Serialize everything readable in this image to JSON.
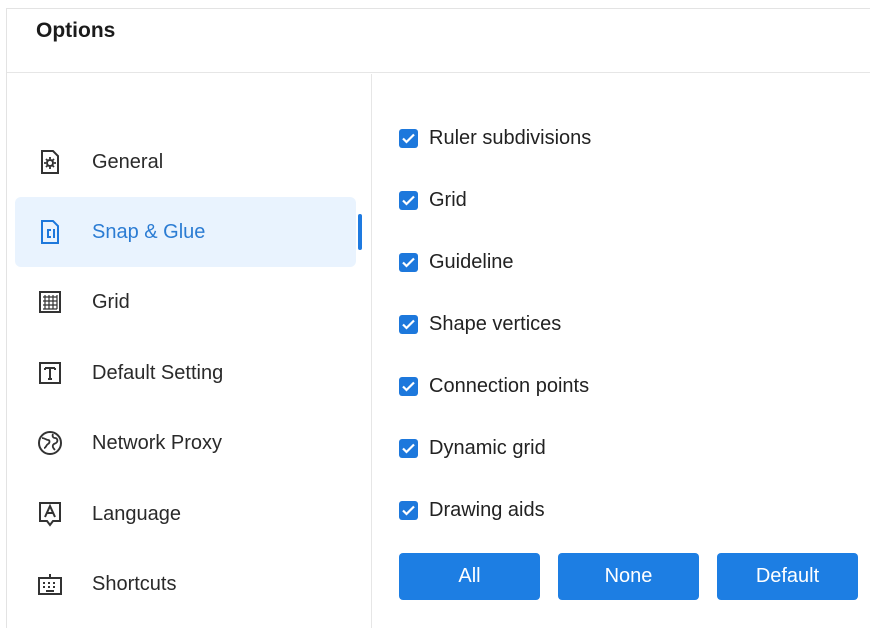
{
  "window": {
    "title": "Options"
  },
  "sidebar": {
    "items": [
      {
        "label": "General",
        "icon": "gear-doc-icon",
        "active": false
      },
      {
        "label": "Snap & Glue",
        "icon": "snap-glue-icon",
        "active": true
      },
      {
        "label": "Grid",
        "icon": "grid-icon",
        "active": false
      },
      {
        "label": "Default Setting",
        "icon": "text-box-icon",
        "active": false
      },
      {
        "label": "Network Proxy",
        "icon": "globe-icon",
        "active": false
      },
      {
        "label": "Language",
        "icon": "language-icon",
        "active": false
      },
      {
        "label": "Shortcuts",
        "icon": "keyboard-icon",
        "active": false
      }
    ]
  },
  "options": {
    "items": [
      {
        "label": "Ruler subdivisions",
        "checked": true
      },
      {
        "label": "Grid",
        "checked": true
      },
      {
        "label": "Guideline",
        "checked": true
      },
      {
        "label": "Shape vertices",
        "checked": true
      },
      {
        "label": "Connection points",
        "checked": true
      },
      {
        "label": "Dynamic grid",
        "checked": true
      },
      {
        "label": "Drawing aids",
        "checked": true
      }
    ]
  },
  "buttons": {
    "all": "All",
    "none": "None",
    "default": "Default"
  },
  "colors": {
    "accent": "#1d7ee3",
    "active_bg": "#e9f3fe",
    "active_text": "#2b7cd3"
  }
}
